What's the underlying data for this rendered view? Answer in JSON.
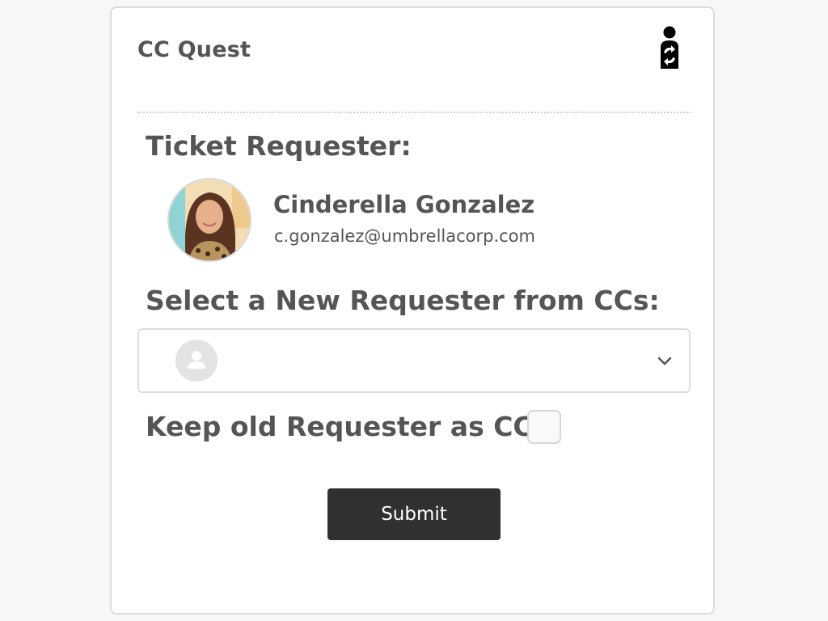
{
  "app": {
    "title": "CC Quest",
    "logo_icon": "person-swap-icon"
  },
  "requester": {
    "heading": "Ticket Requester:",
    "name": "Cinderella Gonzalez",
    "email": "c.gonzalez@umbrellacorp.com",
    "avatar_icon": "user-photo-avatar"
  },
  "new_requester": {
    "heading": "Select a New Requester from CCs:",
    "selected_value": "",
    "placeholder_icon": "user-placeholder-icon",
    "dropdown_icon": "chevron-down-icon"
  },
  "keep_old": {
    "label": "Keep old Requester as CC:",
    "checked": false
  },
  "actions": {
    "submit_label": "Submit"
  },
  "colors": {
    "text": "#555555",
    "button_bg": "#303030",
    "button_text": "#ffffff",
    "border": "#dddddd",
    "background": "#f7f7f7"
  }
}
